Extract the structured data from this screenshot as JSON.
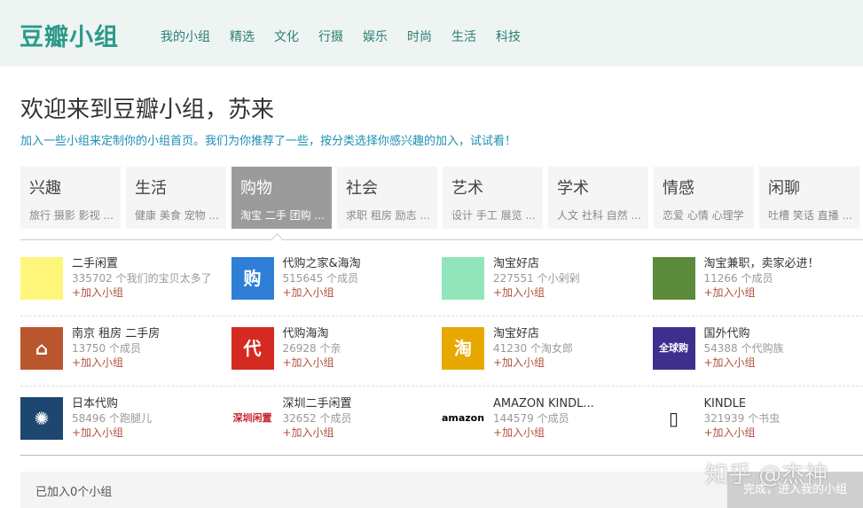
{
  "header": {
    "logo": "豆瓣小组",
    "nav": [
      "我的小组",
      "精选",
      "文化",
      "行摄",
      "娱乐",
      "时尚",
      "生活",
      "科技"
    ]
  },
  "welcome": "欢迎来到豆瓣小组，苏来",
  "subtitle": "加入一些小组来定制你的小组首页。我们为你推荐了一些，按分类选择你感兴趣的加入，试试看！",
  "categories": [
    {
      "title": "兴趣",
      "desc": "旅行 摄影 影视 ..."
    },
    {
      "title": "生活",
      "desc": "健康 美食 宠物 ..."
    },
    {
      "title": "购物",
      "desc": "淘宝 二手 团购 ...",
      "selected": true
    },
    {
      "title": "社会",
      "desc": "求职 租房 励志 ..."
    },
    {
      "title": "艺术",
      "desc": "设计 手工 展览 ..."
    },
    {
      "title": "学术",
      "desc": "人文 社科 自然 ..."
    },
    {
      "title": "情感",
      "desc": "恋爱 心情 心理学"
    },
    {
      "title": "闲聊",
      "desc": "吐槽 笑话 直播 ..."
    }
  ],
  "join_label": "+加入小组",
  "groups": [
    [
      {
        "name": "二手闲置",
        "count": "335702 个我们的宝贝太多了",
        "color": "#fdf67a",
        "icon": ""
      },
      {
        "name": "代购之家&海淘",
        "count": "515645 个成员",
        "color": "#2f7fd6",
        "icon": "购"
      },
      {
        "name": "淘宝好店",
        "count": "227551 个小剁剁",
        "color": "#92e5bb",
        "icon": ""
      },
      {
        "name": "淘宝兼职，卖家必进！",
        "count": "11266 个成员",
        "color": "#5a8a3a",
        "icon": ""
      }
    ],
    [
      {
        "name": "南京 租房 二手房",
        "count": "13750 个成员",
        "color": "#b9562e",
        "icon": "⌂"
      },
      {
        "name": "代购海淘",
        "count": "26928 个亲",
        "color": "#d42a22",
        "icon": "代"
      },
      {
        "name": "淘宝好店",
        "count": "41230 个淘女郎",
        "color": "#e8a800",
        "icon": "淘"
      },
      {
        "name": "国外代购",
        "count": "54388 个代购族",
        "color": "#3e2f8f",
        "icon": "全球购"
      }
    ],
    [
      {
        "name": "日本代购",
        "count": "58496 个跑腿儿",
        "color": "#1d4670",
        "icon": "✺"
      },
      {
        "name": "深圳二手闲置",
        "count": "32652 个成员",
        "color": "#ffffff",
        "icon": "深圳闲置",
        "fg": "#c8202a"
      },
      {
        "name": "AMAZON KINDL...",
        "count": "144579 个成员",
        "color": "#ffffff",
        "icon": "amazon",
        "fg": "#000"
      },
      {
        "name": "KINDLE",
        "count": "321939 个书虫",
        "color": "#ffffff",
        "icon": "▯",
        "fg": "#222"
      }
    ]
  ],
  "footer": {
    "joined": "已加入0个小组",
    "done": "完成，进入我的小组",
    "watermark": "知乎 @杰神"
  }
}
